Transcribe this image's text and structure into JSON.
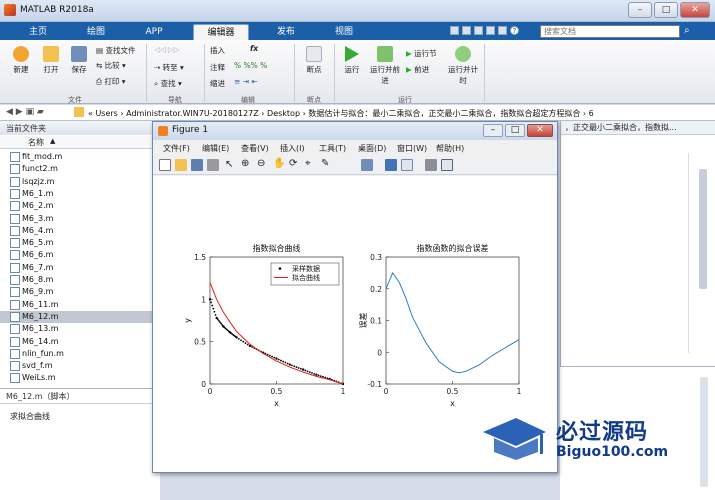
{
  "window": {
    "title": "MATLAB R2018a",
    "min": "–",
    "max": "□",
    "close": "✕"
  },
  "tabs": [
    "主页",
    "绘图",
    "APP",
    "编辑器",
    "发布",
    "视图"
  ],
  "search_placeholder": "搜索文档",
  "ribbon": {
    "file_group": {
      "label": "文件",
      "new": "新建",
      "open": "打开",
      "save": "保存",
      "find_files": "查找文件",
      "compare": "比较",
      "print": "打印"
    },
    "nav_group": {
      "label": "导航",
      "goto": "转至",
      "find": "查找"
    },
    "edit_group": {
      "label": "编辑",
      "insert": "插入",
      "comment": "注释",
      "indent": "缩进",
      "fx": "fx"
    },
    "breakpoints_group": {
      "label": "断点",
      "breakpoints": "断点"
    },
    "run_group": {
      "label": "运行",
      "run": "运行",
      "run_advance": "运行并前进",
      "run_section": "运行节",
      "advance": "前进",
      "run_time": "运行并计时"
    }
  },
  "address": {
    "path": "« Users › Administrator.WIN7U-20180127Z › Desktop › 数据估计与拟合：最小二乘拟合，正交最小二乘拟合，指数拟合超定方程拟合 › 6"
  },
  "right_overflow_path": "，正交最小二乘拟合，指数拟...",
  "current_folder": {
    "title": "当前文件夹",
    "column": "名称",
    "sort_arrow": "▲",
    "files": [
      "fit_mod.m",
      "funct2.m",
      "lsqzjz.m",
      "M6_1.m",
      "M6_2.m",
      "M6_3.m",
      "M6_4.m",
      "M6_5.m",
      "M6_6.m",
      "M6_7.m",
      "M6_8.m",
      "M6_9.m",
      "M6_11.m",
      "M6_12.m",
      "M6_13.m",
      "M6_14.m",
      "nlin_fun.m",
      "svd_f.m",
      "WeiLs.m"
    ],
    "selected": "M6_12.m"
  },
  "details": {
    "file": "M6_12.m（脚本）",
    "description": "求拟合曲线"
  },
  "figure": {
    "title": "Figure 1",
    "menu": [
      "文件(F)",
      "编辑(E)",
      "查看(V)",
      "插入(I)",
      "工具(T)",
      "桌面(D)",
      "窗口(W)",
      "帮助(H)"
    ]
  },
  "chart_data": [
    {
      "type": "line",
      "title": "指数拟合曲线",
      "xlabel": "x",
      "ylabel": "y",
      "xlim": [
        0,
        1
      ],
      "ylim": [
        0,
        1.5
      ],
      "xticks": [
        "0",
        "0.5",
        "1"
      ],
      "yticks": [
        "0",
        "0.5",
        "1",
        "1.5"
      ],
      "legend": "top-right",
      "series": [
        {
          "name": "采样数据",
          "color": "#000000",
          "style": "dots",
          "x": [
            0,
            0.05,
            0.1,
            0.15,
            0.2,
            0.3,
            0.4,
            0.5,
            0.6,
            0.7,
            0.8,
            0.9,
            1.0
          ],
          "y": [
            1.0,
            0.78,
            0.68,
            0.61,
            0.55,
            0.45,
            0.37,
            0.3,
            0.23,
            0.17,
            0.11,
            0.06,
            0.0
          ]
        },
        {
          "name": "拟合曲线",
          "color": "#e0201b",
          "style": "line",
          "x": [
            0,
            0.05,
            0.1,
            0.15,
            0.2,
            0.3,
            0.4,
            0.5,
            0.6,
            0.7,
            0.8,
            0.9,
            1.0
          ],
          "y": [
            1.2,
            1.0,
            0.85,
            0.73,
            0.62,
            0.47,
            0.36,
            0.27,
            0.2,
            0.14,
            0.09,
            0.05,
            0.0
          ]
        }
      ]
    },
    {
      "type": "line",
      "title": "指数函数的拟合误差",
      "xlabel": "x",
      "ylabel": "误差",
      "xlim": [
        0,
        1
      ],
      "ylim": [
        -0.1,
        0.3
      ],
      "xticks": [
        "0",
        "0.5",
        "1"
      ],
      "yticks": [
        "-0.1",
        "0",
        "0.1",
        "0.2",
        "0.3"
      ],
      "series": [
        {
          "color": "#2f7fc1",
          "x": [
            0,
            0.05,
            0.1,
            0.15,
            0.2,
            0.3,
            0.4,
            0.5,
            0.55,
            0.6,
            0.7,
            0.8,
            0.9,
            1.0
          ],
          "y": [
            0.2,
            0.25,
            0.22,
            0.17,
            0.11,
            0.03,
            -0.03,
            -0.06,
            -0.065,
            -0.06,
            -0.04,
            -0.01,
            0.015,
            0.04
          ]
        }
      ]
    }
  ],
  "watermark": {
    "title": "必过源码",
    "url": "Biguo100.com"
  }
}
